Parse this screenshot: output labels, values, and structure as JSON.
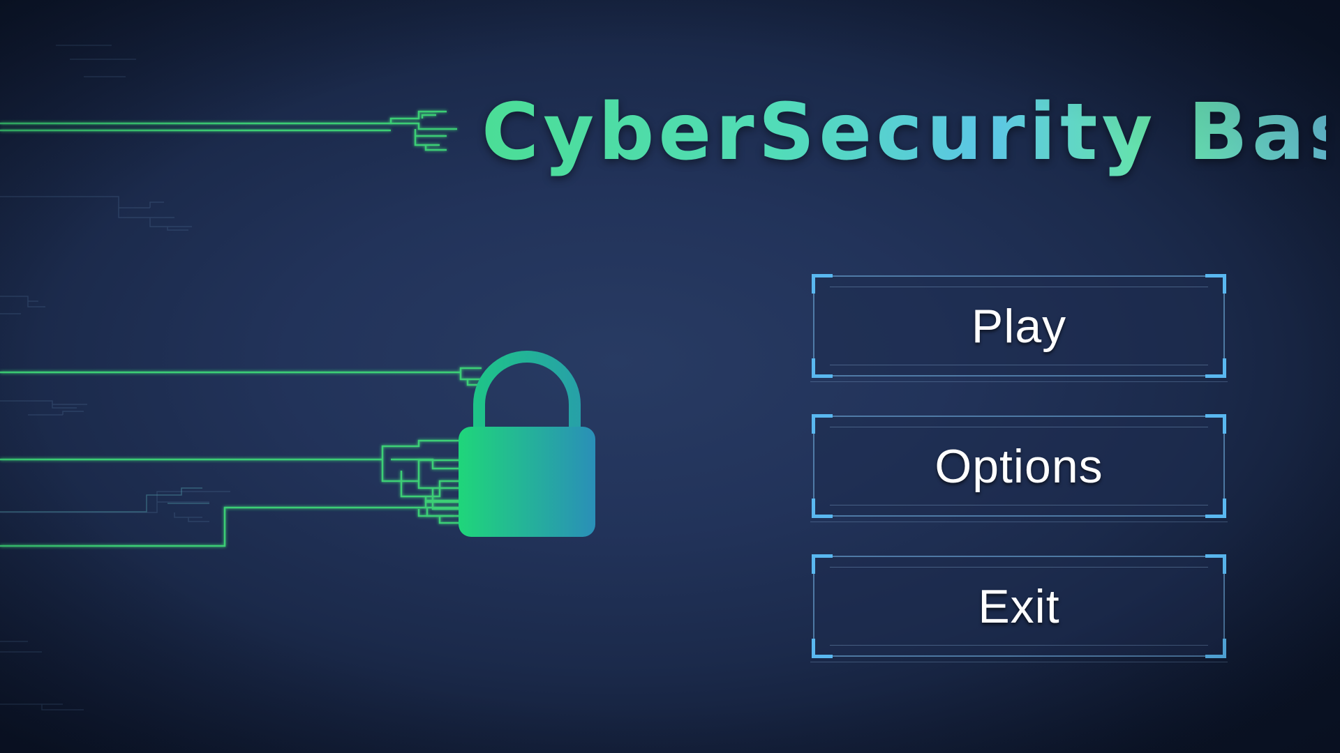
{
  "title": "CyberSecurity Basics",
  "menu": {
    "play_label": "Play",
    "options_label": "Options",
    "exit_label": "Exit"
  },
  "icons": {
    "lock": "padlock-icon"
  },
  "colors": {
    "circuit_green": "#3fe07a",
    "lock_gradient_start": "#1fd67a",
    "lock_gradient_end": "#2a8fb8",
    "button_accent": "#5ab8f0"
  }
}
